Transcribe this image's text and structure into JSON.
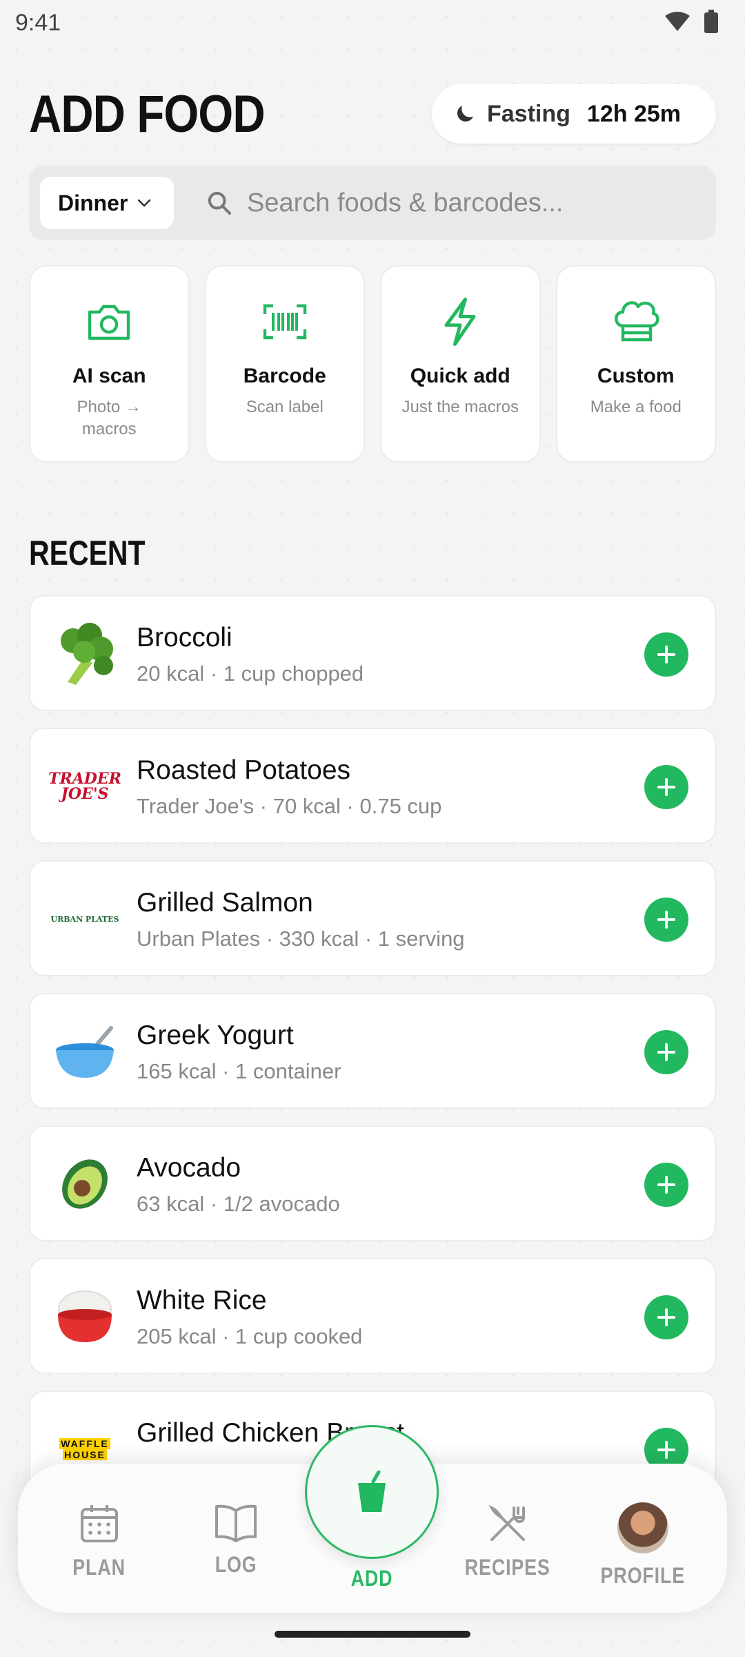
{
  "status_bar": {
    "time": "9:41"
  },
  "header": {
    "title": "ADD FOOD"
  },
  "fasting": {
    "label": "Fasting",
    "time": "12h 25m"
  },
  "search": {
    "meal": "Dinner",
    "placeholder": "Search foods & barcodes..."
  },
  "quick_actions": [
    {
      "title": "AI scan",
      "subtitle": "Photo → macros",
      "icon": "camera-icon"
    },
    {
      "title": "Barcode",
      "subtitle": "Scan label",
      "icon": "barcode-icon"
    },
    {
      "title": "Quick add",
      "subtitle": "Just the macros",
      "icon": "lightning-icon"
    },
    {
      "title": "Custom",
      "subtitle": "Make a food",
      "icon": "chef-hat-icon"
    }
  ],
  "recent": {
    "title": "RECENT",
    "items": [
      {
        "name": "Broccoli",
        "meta": "20 kcal · 1 cup chopped",
        "thumb": "broccoli-icon"
      },
      {
        "name": "Roasted Potatoes",
        "meta": "Trader Joe's · 70 kcal · 0.75 cup",
        "thumb": "trader-joes-logo",
        "logo_lines": [
          "TRADER",
          "JOE'S"
        ]
      },
      {
        "name": "Grilled Salmon",
        "meta": "Urban Plates · 330 kcal · 1 serving",
        "thumb": "urban-plates-logo",
        "logo_text": "URBAN PLATES"
      },
      {
        "name": "Greek Yogurt",
        "meta": "165 kcal · 1 container",
        "thumb": "bowl-icon"
      },
      {
        "name": "Avocado",
        "meta": "63 kcal · 1/2 avocado",
        "thumb": "avocado-icon"
      },
      {
        "name": "White Rice",
        "meta": "205 kcal · 1 cup cooked",
        "thumb": "rice-bowl-icon"
      },
      {
        "name": "Grilled Chicken Breast",
        "meta": "",
        "thumb": "waffle-house-logo",
        "logo_lines": [
          "WAFFLE",
          "HOUSE"
        ]
      }
    ]
  },
  "nav": {
    "plan": "PLAN",
    "log": "LOG",
    "add": "ADD",
    "recipes": "RECIPES",
    "profile": "PROFILE"
  },
  "colors": {
    "accent": "#22b860",
    "text": "#111111",
    "muted": "#888888"
  }
}
